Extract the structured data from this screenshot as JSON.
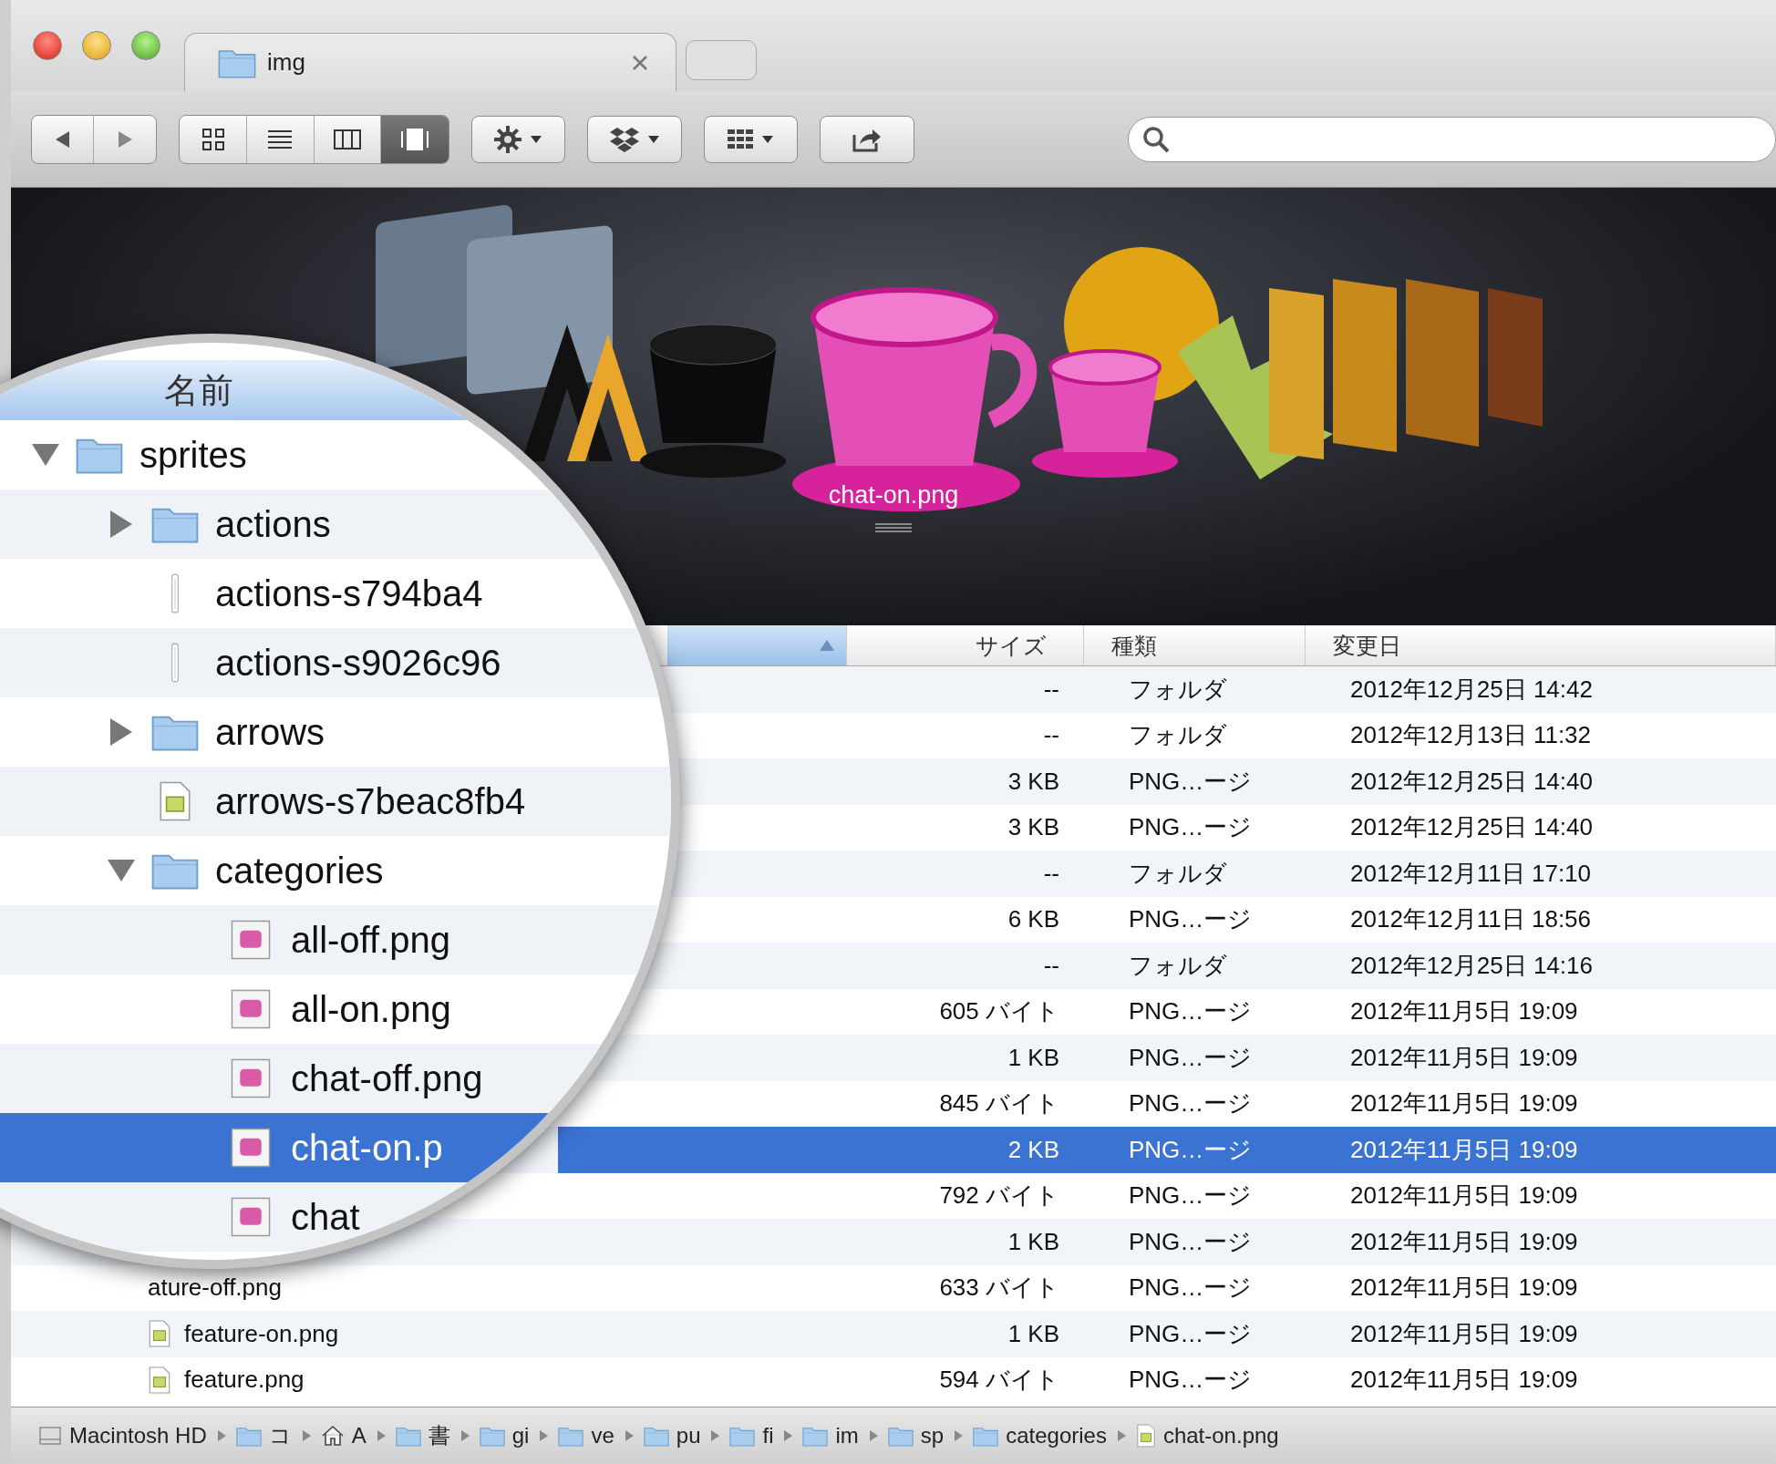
{
  "window": {
    "tabs": [
      {
        "title": "img",
        "selected": true
      }
    ]
  },
  "toolbar": {
    "view_modes": [
      {
        "kind": "icons",
        "selected": false
      },
      {
        "kind": "list",
        "selected": false
      },
      {
        "kind": "columns",
        "selected": false
      },
      {
        "kind": "coverflow",
        "selected": true
      }
    ]
  },
  "cover_flow": {
    "caption": "chat-on.png"
  },
  "table": {
    "columns": [
      {
        "label": "サイズ"
      },
      {
        "label": "種類"
      },
      {
        "label": "変更日"
      }
    ],
    "sort_ascending": true,
    "rows": [
      {
        "size": "--",
        "file_type": "フォルダ",
        "modified": "2012年12月25日 14:42",
        "selected": false
      },
      {
        "size": "--",
        "file_type": "フォルダ",
        "modified": "2012年12月13日 11:32",
        "selected": false
      },
      {
        "size": "3 KB",
        "file_type": "PNG…ージ",
        "modified": "2012年12月25日 14:40",
        "selected": false
      },
      {
        "size": "3 KB",
        "file_type": "PNG…ージ",
        "modified": "2012年12月25日 14:40",
        "selected": false
      },
      {
        "size": "--",
        "file_type": "フォルダ",
        "modified": "2012年12月11日 17:10",
        "selected": false
      },
      {
        "size": "6 KB",
        "file_type": "PNG…ージ",
        "modified": "2012年12月11日 18:56",
        "selected": false
      },
      {
        "size": "--",
        "file_type": "フォルダ",
        "modified": "2012年12月25日 14:16",
        "selected": false
      },
      {
        "size": "605 バイト",
        "file_type": "PNG…ージ",
        "modified": "2012年11月5日 19:09",
        "selected": false
      },
      {
        "size": "1 KB",
        "file_type": "PNG…ージ",
        "modified": "2012年11月5日 19:09",
        "selected": false
      },
      {
        "size": "845 バイト",
        "file_type": "PNG…ージ",
        "modified": "2012年11月5日 19:09",
        "selected": false
      },
      {
        "size": "2 KB",
        "file_type": "PNG…ージ",
        "modified": "2012年11月5日 19:09",
        "selected": true
      },
      {
        "size": "792 バイト",
        "file_type": "PNG…ージ",
        "modified": "2012年11月5日 19:09",
        "selected": false
      },
      {
        "size": "1 KB",
        "file_type": "PNG…ージ",
        "modified": "2012年11月5日 19:09",
        "selected": false
      },
      {
        "name": "ature-off.png",
        "size": "633 バイト",
        "file_type": "PNG…ージ",
        "modified": "2012年11月5日 19:09",
        "selected": false
      },
      {
        "name": "feature-on.png",
        "kind": "image",
        "size": "1 KB",
        "file_type": "PNG…ージ",
        "modified": "2012年11月5日 19:09",
        "selected": false
      },
      {
        "name": "feature.png",
        "kind": "image",
        "size": "594 バイト",
        "file_type": "PNG…ージ",
        "modified": "2012年11月5日 19:09",
        "selected": false
      }
    ]
  },
  "magnifier": {
    "header": "名前",
    "tree": [
      {
        "name": "sprites",
        "kind": "folder",
        "expanded": true,
        "selected": false,
        "children": [
          {
            "name": "actions",
            "kind": "folder",
            "expanded": false,
            "selected": false
          },
          {
            "name": "actions-s794ba4",
            "kind": "strip",
            "selected": false
          },
          {
            "name": "actions-s9026c96",
            "kind": "strip",
            "selected": false
          },
          {
            "name": "arrows",
            "kind": "folder",
            "expanded": false,
            "selected": false
          },
          {
            "name": "arrows-s7beac8fb4",
            "kind": "image",
            "selected": false
          },
          {
            "name": "categories",
            "kind": "folder",
            "expanded": true,
            "selected": false,
            "children": [
              {
                "name": "all-off.png",
                "kind": "thumbnail",
                "selected": false
              },
              {
                "name": "all-on.png",
                "kind": "thumbnail",
                "selected": false
              },
              {
                "name": "chat-off.png",
                "kind": "thumbnail",
                "selected": false
              },
              {
                "name": "chat-on.p",
                "kind": "thumbnail",
                "selected": true
              },
              {
                "name": "chat",
                "kind": "thumbnail",
                "selected": false
              }
            ]
          }
        ]
      }
    ]
  },
  "path_bar": [
    {
      "label": "Macintosh HD",
      "kind": "disk"
    },
    {
      "label": "コ",
      "kind": "folder"
    },
    {
      "label": "A",
      "kind": "home"
    },
    {
      "label": "書",
      "kind": "folder"
    },
    {
      "label": "gi",
      "kind": "folder"
    },
    {
      "label": "ve",
      "kind": "folder"
    },
    {
      "label": "pu",
      "kind": "folder"
    },
    {
      "label": "fi",
      "kind": "folder"
    },
    {
      "label": "im",
      "kind": "folder"
    },
    {
      "label": "sp",
      "kind": "folder"
    },
    {
      "label": "categories",
      "kind": "folder"
    },
    {
      "label": "chat-on.png",
      "kind": "file"
    }
  ]
}
